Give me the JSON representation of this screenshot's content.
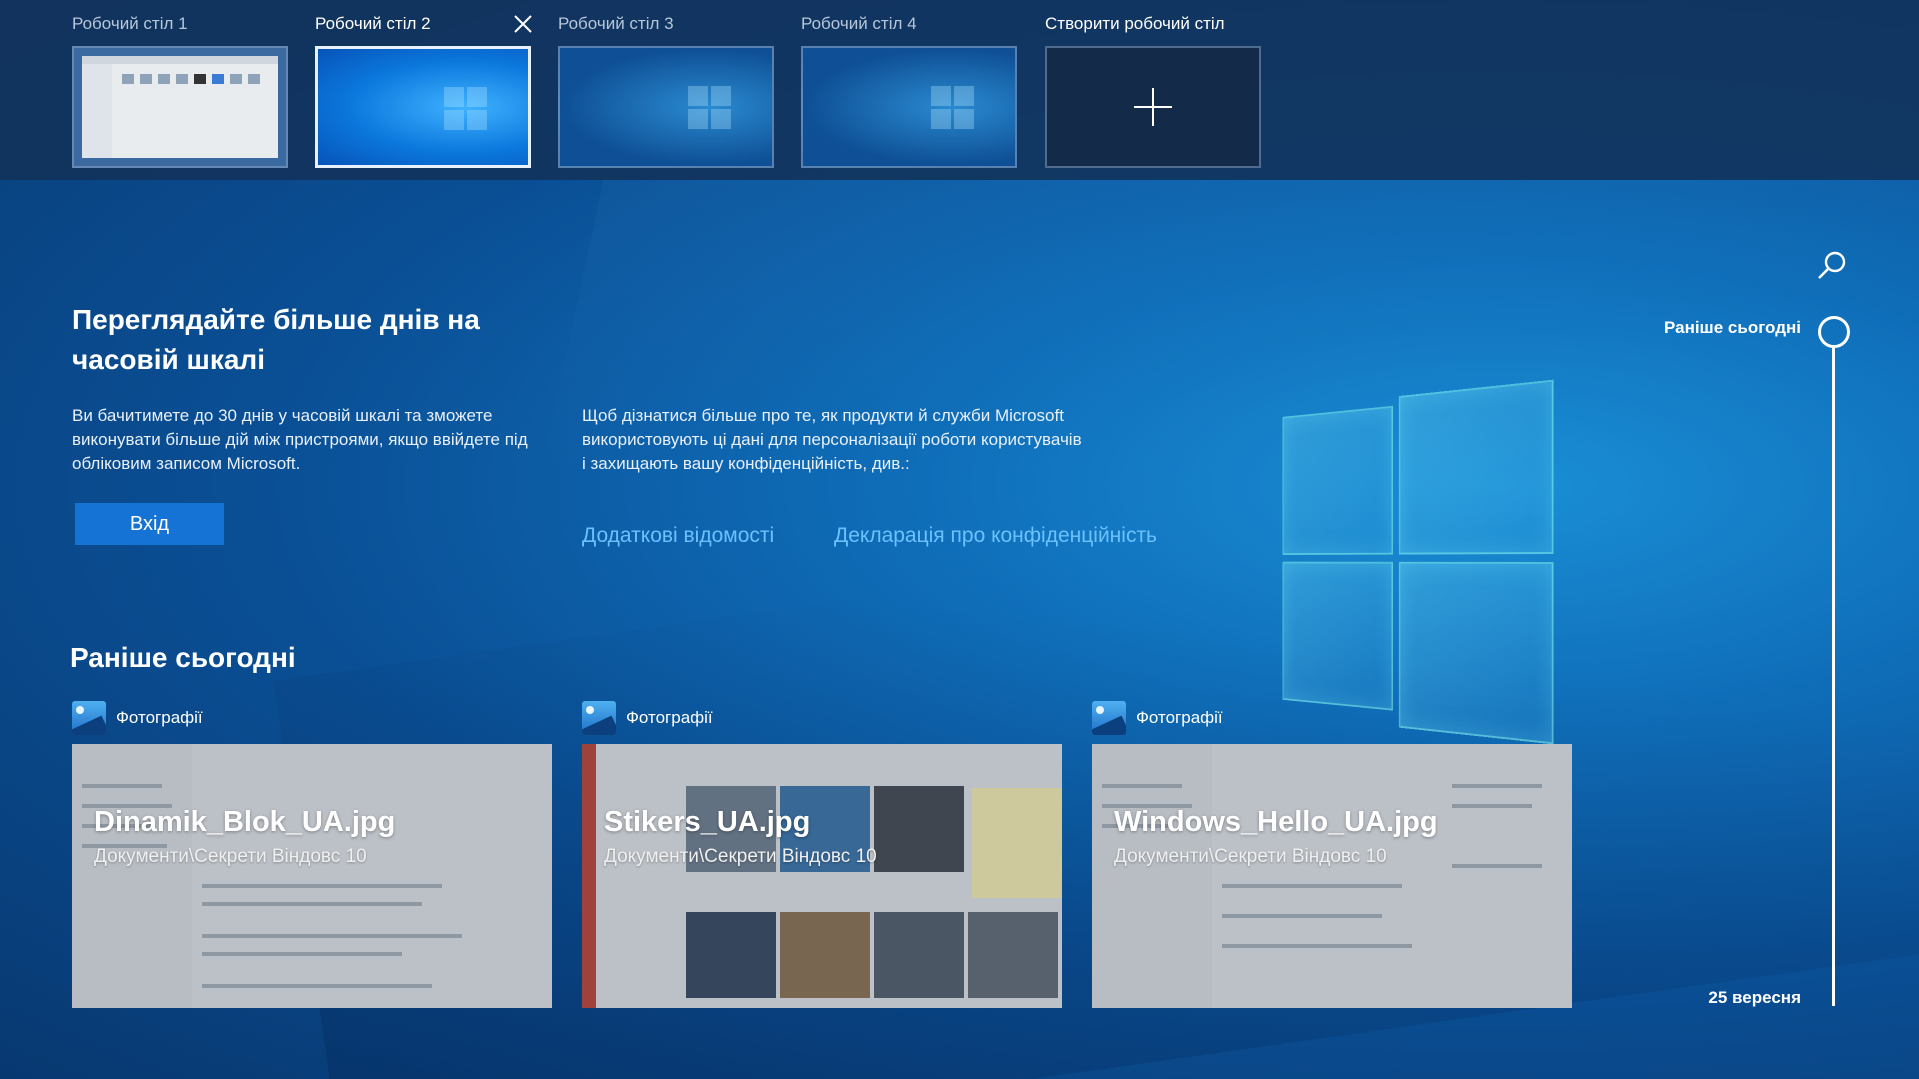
{
  "desktops": [
    {
      "label": "Робочий стіл 1",
      "active": false
    },
    {
      "label": "Робочий стіл 2",
      "active": true
    },
    {
      "label": "Робочий стіл 3",
      "active": false
    },
    {
      "label": "Робочий стіл 4",
      "active": false
    }
  ],
  "new_desktop_label": "Створити робочий стіл",
  "promo": {
    "title": "Переглядайте більше днів на часовій шкалі",
    "text": "Ви бачитимете до 30 днів у часовій шкалі та зможете виконувати більше дій між пристроями, якщо ввійдете під обліковим записом Microsoft.",
    "signin_label": "Вхід",
    "privacy_text": "Щоб дізнатися більше про те, як продукти й служби Microsoft використовують ці дані для персоналізації роботи користувачів і захищають вашу конфіденційність, див.:",
    "link_more": "Додаткові відомості",
    "link_privacy": "Декларація про конфіденційність"
  },
  "section_title": "Раніше сьогодні",
  "cards": [
    {
      "app": "Фотографії",
      "title": "Dinamik_Blok_UA.jpg",
      "path": "Документи\\Секрети Віндовс 10"
    },
    {
      "app": "Фотографії",
      "title": "Stikers_UA.jpg",
      "path": "Документи\\Секрети Віндовс 10"
    },
    {
      "app": "Фотографії",
      "title": "Windows_Hello_UA.jpg",
      "path": "Документи\\Секрети Віндовс 10"
    }
  ],
  "timeline": {
    "top_label": "Раніше сьогодні",
    "bottom_label": "25 вересня"
  },
  "colors": {
    "accent": "#1573d6",
    "link": "#6cc1ff"
  }
}
